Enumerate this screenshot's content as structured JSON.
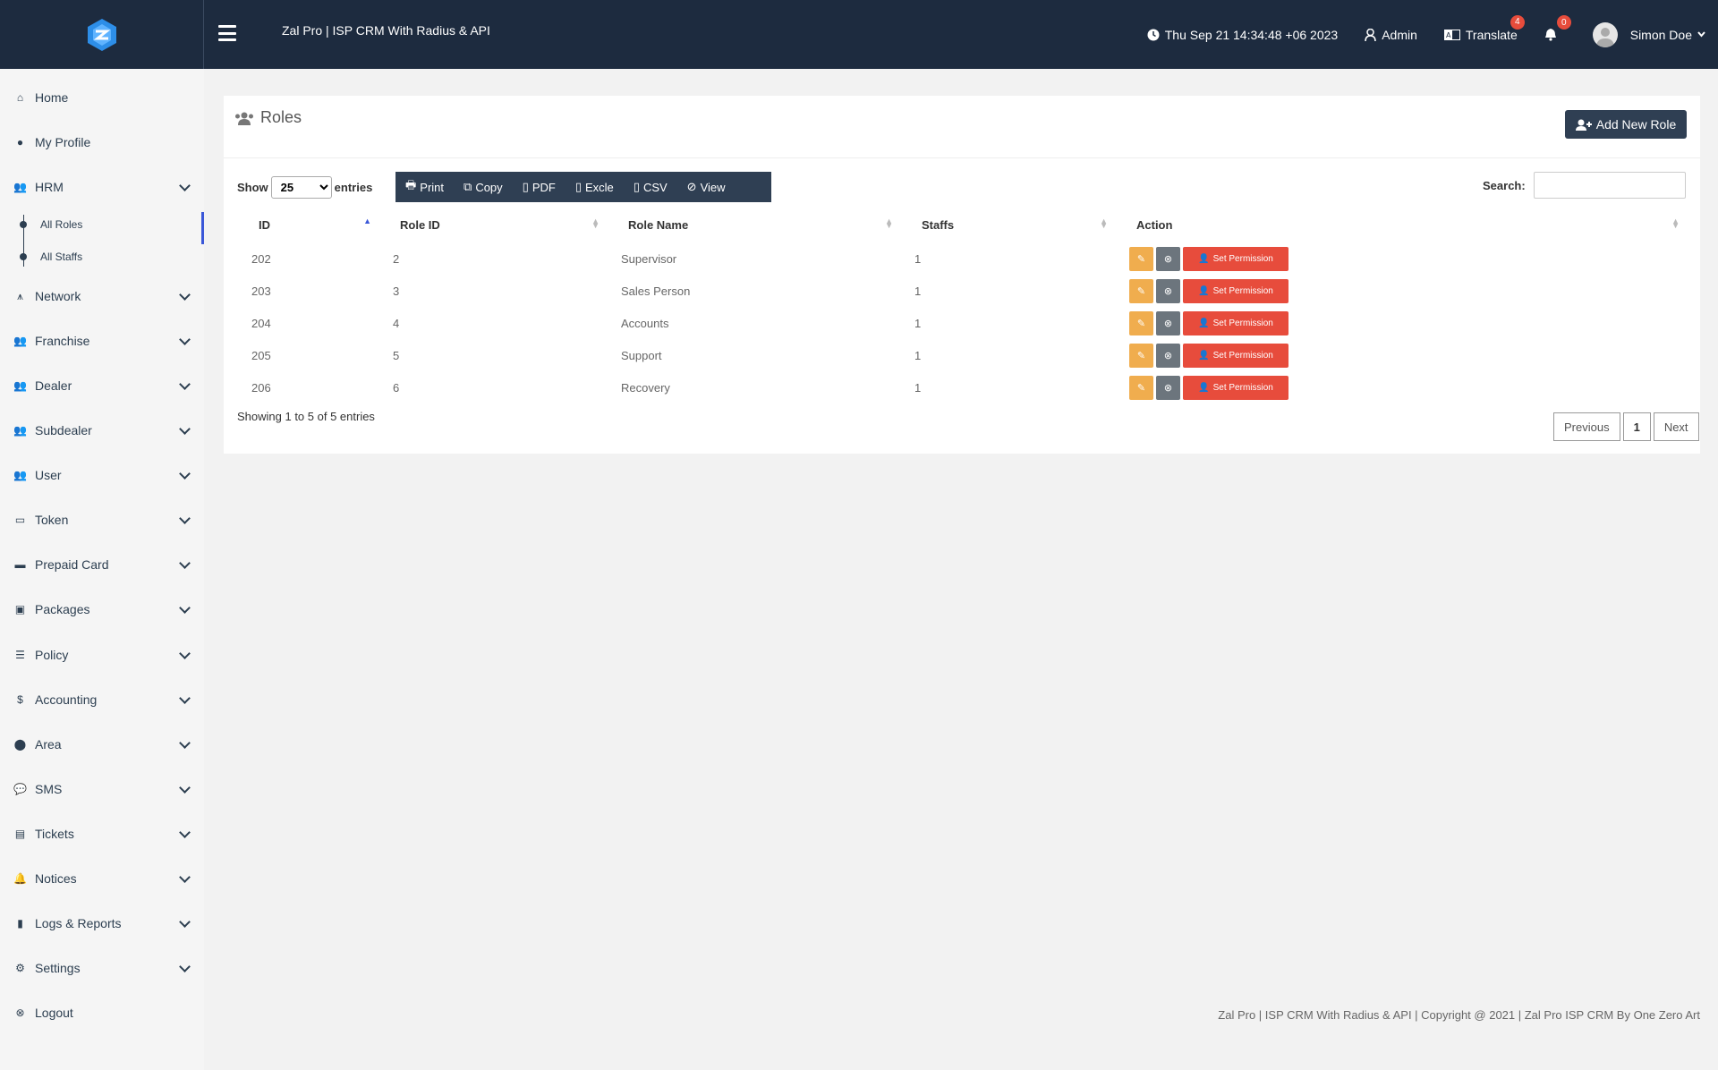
{
  "header": {
    "app_title": "Zal Pro | ISP CRM With Radius & API",
    "datetime": "Thu Sep 21 14:34:48 +06 2023",
    "admin_label": "Admin",
    "translate_label": "Translate",
    "translate_badge": "4",
    "notif_badge": "0",
    "user_name": "Simon Doe"
  },
  "sidebar": {
    "items": [
      {
        "label": "Home",
        "icon": "home-icon"
      },
      {
        "label": "My Profile",
        "icon": "user-icon"
      },
      {
        "label": "HRM",
        "icon": "users-icon"
      },
      {
        "label": "Network",
        "icon": "antenna-icon"
      },
      {
        "label": "Franchise",
        "icon": "users-icon"
      },
      {
        "label": "Dealer",
        "icon": "users-icon"
      },
      {
        "label": "Subdealer",
        "icon": "users-icon"
      },
      {
        "label": "User",
        "icon": "users-icon"
      },
      {
        "label": "Token",
        "icon": "ticket-icon"
      },
      {
        "label": "Prepaid Card",
        "icon": "card-icon"
      },
      {
        "label": "Packages",
        "icon": "box-icon"
      },
      {
        "label": "Policy",
        "icon": "sliders-icon"
      },
      {
        "label": "Accounting",
        "icon": "dollar-icon"
      },
      {
        "label": "Area",
        "icon": "map-pin-icon"
      },
      {
        "label": "SMS",
        "icon": "chat-icon"
      },
      {
        "label": "Tickets",
        "icon": "document-icon"
      },
      {
        "label": "Notices",
        "icon": "bell-icon"
      },
      {
        "label": "Logs & Reports",
        "icon": "book-icon"
      },
      {
        "label": "Settings",
        "icon": "gears-icon"
      },
      {
        "label": "Logout",
        "icon": "logout-icon"
      }
    ],
    "sub_items": [
      "All Roles",
      "All Staffs"
    ]
  },
  "page": {
    "title": "Roles",
    "add_button": "Add New Role",
    "show_label": "Show",
    "entries_value": "25",
    "entries_label": "entries",
    "search_label": "Search:",
    "toolbar": [
      "Print",
      "Copy",
      "PDF",
      "Excle",
      "CSV",
      "View"
    ],
    "columns": [
      "ID",
      "Role ID",
      "Role Name",
      "Staffs",
      "Action"
    ],
    "rows": [
      {
        "id": "202",
        "role_id": "2",
        "name": "Supervisor",
        "staffs": "1"
      },
      {
        "id": "203",
        "role_id": "3",
        "name": "Sales Person",
        "staffs": "1"
      },
      {
        "id": "204",
        "role_id": "4",
        "name": "Accounts",
        "staffs": "1"
      },
      {
        "id": "205",
        "role_id": "5",
        "name": "Support",
        "staffs": "1"
      },
      {
        "id": "206",
        "role_id": "6",
        "name": "Recovery",
        "staffs": "1"
      }
    ],
    "permission_label": "Set Permission",
    "showing_text": "Showing 1 to 5 of 5 entries",
    "prev_label": "Previous",
    "page_num": "1",
    "next_label": "Next"
  },
  "footer": {
    "text": "Zal Pro | ISP CRM With Radius & API | Copyright @ 2021 | Zal Pro ISP CRM By One Zero Art"
  },
  "colors": {
    "topbar": "#1d2b3f",
    "button_dark": "#2f3f53",
    "edit": "#f0ad4e",
    "delete": "#6c757d",
    "permission": "#e74c3c",
    "active": "#3a57d8"
  }
}
